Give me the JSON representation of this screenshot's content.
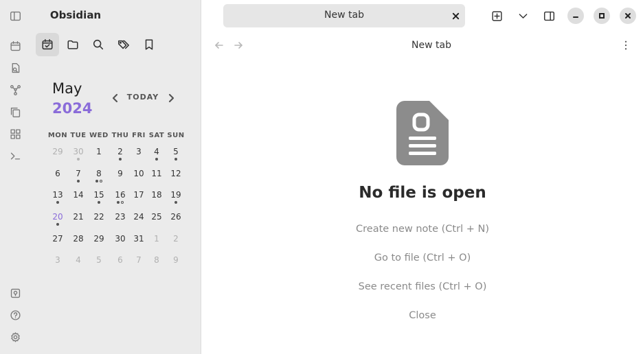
{
  "app": {
    "title": "Obsidian"
  },
  "ribbon": {
    "top_icons": [
      "sidebar-toggle-icon",
      "calendar-icon",
      "file-search-icon",
      "graph-icon",
      "copy-icon",
      "canvas-icon",
      "terminal-icon"
    ],
    "bottom_icons": [
      "vault-icon",
      "help-icon",
      "settings-icon"
    ]
  },
  "sidebar": {
    "tabs": [
      {
        "name": "calendar-check-icon",
        "active": true
      },
      {
        "name": "folder-icon",
        "active": false
      },
      {
        "name": "search-icon",
        "active": false
      },
      {
        "name": "tags-icon",
        "active": false
      },
      {
        "name": "bookmark-icon",
        "active": false
      }
    ]
  },
  "calendar": {
    "month": "May",
    "year": "2024",
    "today_label": "TODAY",
    "weekdays": [
      "MON",
      "TUE",
      "WED",
      "THU",
      "FRI",
      "SAT",
      "SUN"
    ],
    "weeks": [
      [
        {
          "d": "29",
          "muted": true,
          "dots": []
        },
        {
          "d": "30",
          "muted": true,
          "dots": [
            "solid"
          ]
        },
        {
          "d": "1",
          "dots": []
        },
        {
          "d": "2",
          "dots": [
            "solid"
          ]
        },
        {
          "d": "3",
          "dots": []
        },
        {
          "d": "4",
          "dots": [
            "solid"
          ]
        },
        {
          "d": "5",
          "dots": [
            "solid"
          ]
        }
      ],
      [
        {
          "d": "6",
          "dots": []
        },
        {
          "d": "7",
          "dots": [
            "solid"
          ]
        },
        {
          "d": "8",
          "dots": [
            "solid",
            "hollow"
          ]
        },
        {
          "d": "9",
          "dots": []
        },
        {
          "d": "10",
          "dots": []
        },
        {
          "d": "11",
          "dots": []
        },
        {
          "d": "12",
          "dots": []
        }
      ],
      [
        {
          "d": "13",
          "dots": [
            "solid"
          ]
        },
        {
          "d": "14",
          "dots": []
        },
        {
          "d": "15",
          "dots": [
            "solid"
          ]
        },
        {
          "d": "16",
          "dots": [
            "solid",
            "hollow"
          ]
        },
        {
          "d": "17",
          "dots": []
        },
        {
          "d": "18",
          "dots": []
        },
        {
          "d": "19",
          "dots": [
            "solid"
          ]
        }
      ],
      [
        {
          "d": "20",
          "today": true,
          "dots": [
            "solid"
          ]
        },
        {
          "d": "21",
          "dots": []
        },
        {
          "d": "22",
          "dots": []
        },
        {
          "d": "23",
          "dots": []
        },
        {
          "d": "24",
          "dots": []
        },
        {
          "d": "25",
          "dots": []
        },
        {
          "d": "26",
          "dots": []
        }
      ],
      [
        {
          "d": "27",
          "dots": []
        },
        {
          "d": "28",
          "dots": []
        },
        {
          "d": "29",
          "dots": []
        },
        {
          "d": "30",
          "dots": []
        },
        {
          "d": "31",
          "dots": []
        },
        {
          "d": "1",
          "muted": true,
          "dots": []
        },
        {
          "d": "2",
          "muted": true,
          "dots": []
        }
      ],
      [
        {
          "d": "3",
          "muted": true,
          "dots": []
        },
        {
          "d": "4",
          "muted": true,
          "dots": []
        },
        {
          "d": "5",
          "muted": true,
          "dots": []
        },
        {
          "d": "6",
          "muted": true,
          "dots": []
        },
        {
          "d": "7",
          "muted": true,
          "dots": []
        },
        {
          "d": "8",
          "muted": true,
          "dots": []
        },
        {
          "d": "9",
          "muted": true,
          "dots": []
        }
      ]
    ]
  },
  "tab": {
    "label": "New tab"
  },
  "header": {
    "title": "New tab"
  },
  "empty_state": {
    "title": "No file is open",
    "actions": [
      "Create new note (Ctrl + N)",
      "Go to file (Ctrl + O)",
      "See recent files (Ctrl + O)",
      "Close"
    ]
  },
  "colors": {
    "accent": "#8a6cd9",
    "sidebar_bg": "#ebebeb"
  }
}
